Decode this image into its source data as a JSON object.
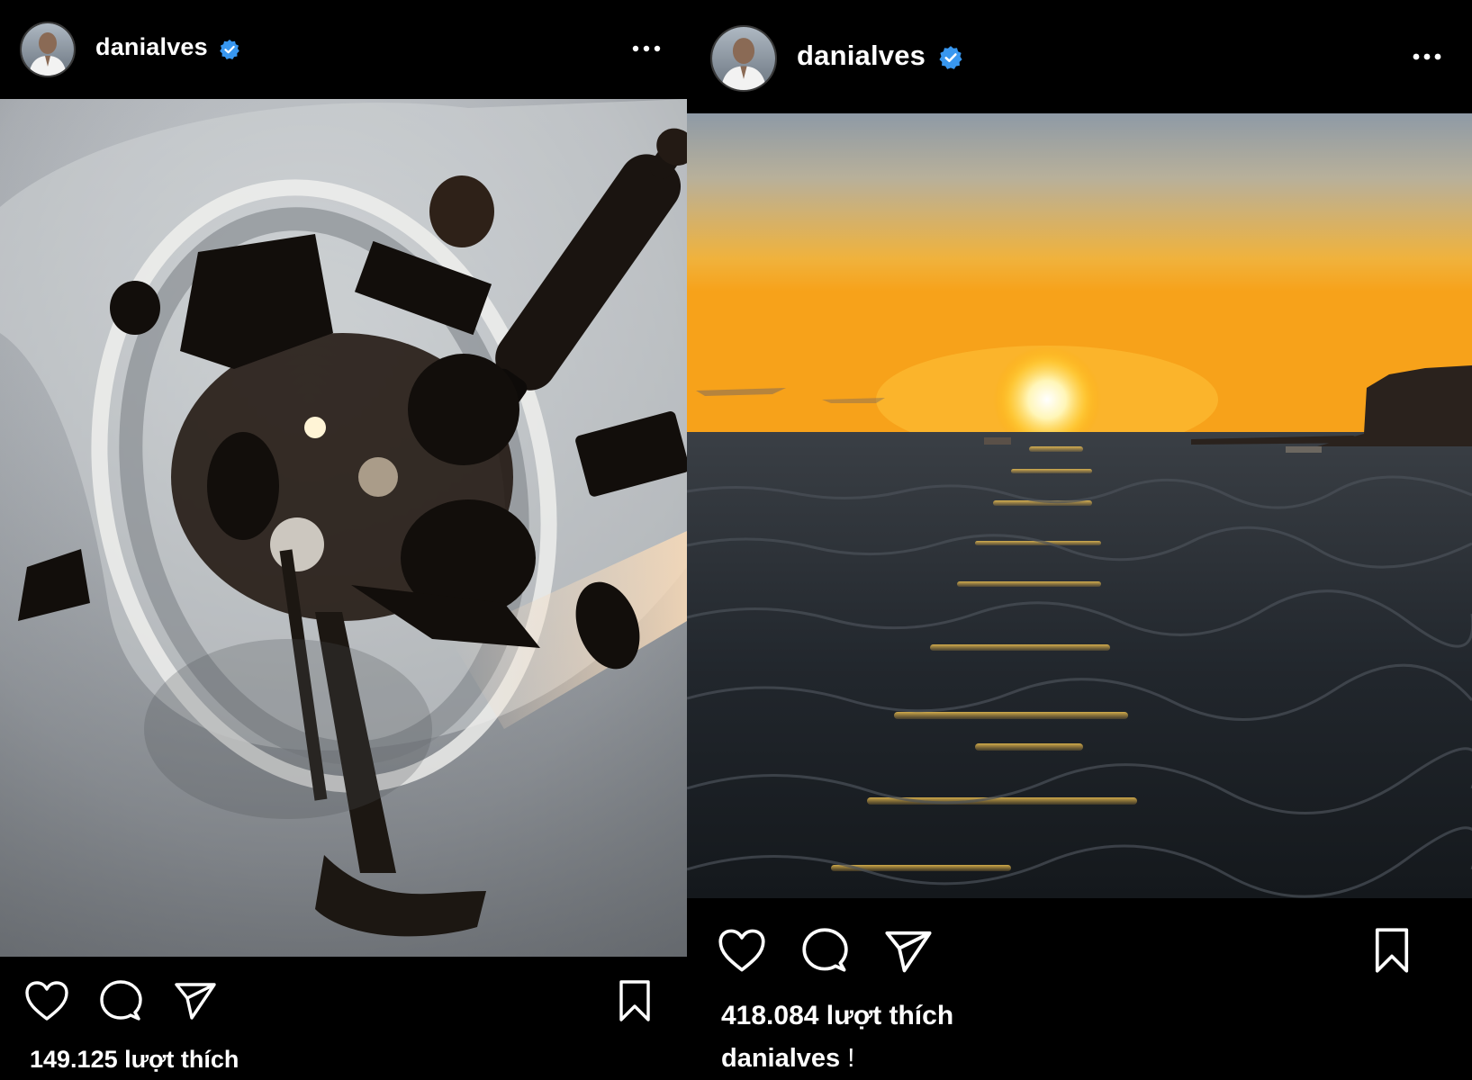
{
  "posts": [
    {
      "username": "danialves",
      "verified": true,
      "likes": "149.125 lượt thích",
      "photo": "ceiling sculpture of suspended objects (chairs, trumpet, rolling pin, pans)"
    },
    {
      "username": "danialves",
      "verified": true,
      "likes": "418.084 lượt thích",
      "caption_user": "danialves",
      "caption_text": "!",
      "photo": "sunset over the sea with rocky cliff"
    }
  ],
  "icons": {
    "verified": "verified-badge-icon",
    "more": "more-options-icon",
    "like": "heart-icon",
    "comment": "comment-icon",
    "share": "paper-plane-icon",
    "save": "bookmark-icon"
  },
  "colors": {
    "background": "#000000",
    "text": "#ffffff",
    "verified": "#3897f0"
  }
}
